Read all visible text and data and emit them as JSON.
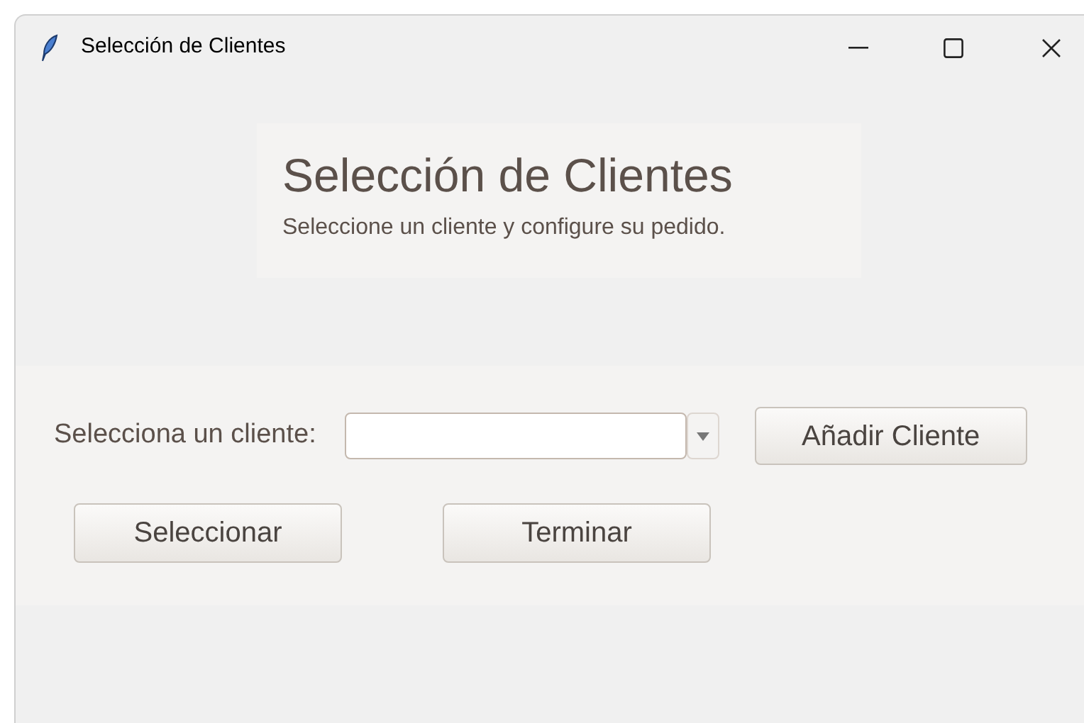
{
  "window": {
    "title": "Selección de Clientes"
  },
  "header": {
    "title": "Selección de Clientes",
    "subtitle": "Seleccione un cliente y configure su pedido."
  },
  "form": {
    "label": "Selecciona un cliente:",
    "add_button": "Añadir Cliente"
  },
  "buttons": [
    "Seleccionar",
    "Terminar"
  ]
}
